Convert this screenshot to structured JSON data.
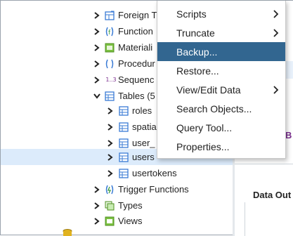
{
  "tree": {
    "items": [
      {
        "label": "Foreign T",
        "icon": "foreign-table-icon",
        "expanded": false
      },
      {
        "label": "Function",
        "icon": "function-icon",
        "expanded": false
      },
      {
        "label": "Materiali",
        "icon": "materialized-view-icon",
        "expanded": false
      },
      {
        "label": "Procedur",
        "icon": "procedure-icon",
        "expanded": false
      },
      {
        "label": "Sequenc",
        "icon": "sequence-icon",
        "icon_text": "1..3",
        "expanded": false
      },
      {
        "label": "Tables (5",
        "icon": "tables-icon",
        "expanded": true
      },
      {
        "label": "roles",
        "icon": "table-icon",
        "expanded": false
      },
      {
        "label": "spatia",
        "icon": "table-icon",
        "expanded": false
      },
      {
        "label": "user_",
        "icon": "table-icon",
        "expanded": false
      },
      {
        "label": "users",
        "icon": "table-icon",
        "expanded": false,
        "selected": true
      },
      {
        "label": "usertokens",
        "icon": "table-icon",
        "expanded": false
      },
      {
        "label": "Trigger Functions",
        "icon": "trigger-function-icon",
        "expanded": false
      },
      {
        "label": "Types",
        "icon": "types-icon",
        "expanded": false
      },
      {
        "label": "Views",
        "icon": "views-icon",
        "expanded": false
      }
    ]
  },
  "context_menu": {
    "items": [
      {
        "label": "Scripts",
        "submenu": true
      },
      {
        "label": "Truncate",
        "submenu": true
      },
      {
        "label": "Backup...",
        "submenu": false,
        "active": true
      },
      {
        "label": "Restore...",
        "submenu": false
      },
      {
        "label": "View/Edit Data",
        "submenu": true
      },
      {
        "label": "Search Objects...",
        "submenu": false
      },
      {
        "label": "Query Tool...",
        "submenu": false
      },
      {
        "label": "Properties...",
        "submenu": false
      }
    ]
  },
  "right_panel": {
    "b_fragment": "B",
    "data_output_label": "Data Out"
  },
  "colors": {
    "menu_active": "#326690",
    "selected_row": "#dcebfb",
    "table_icon": "#3a7bd5"
  }
}
